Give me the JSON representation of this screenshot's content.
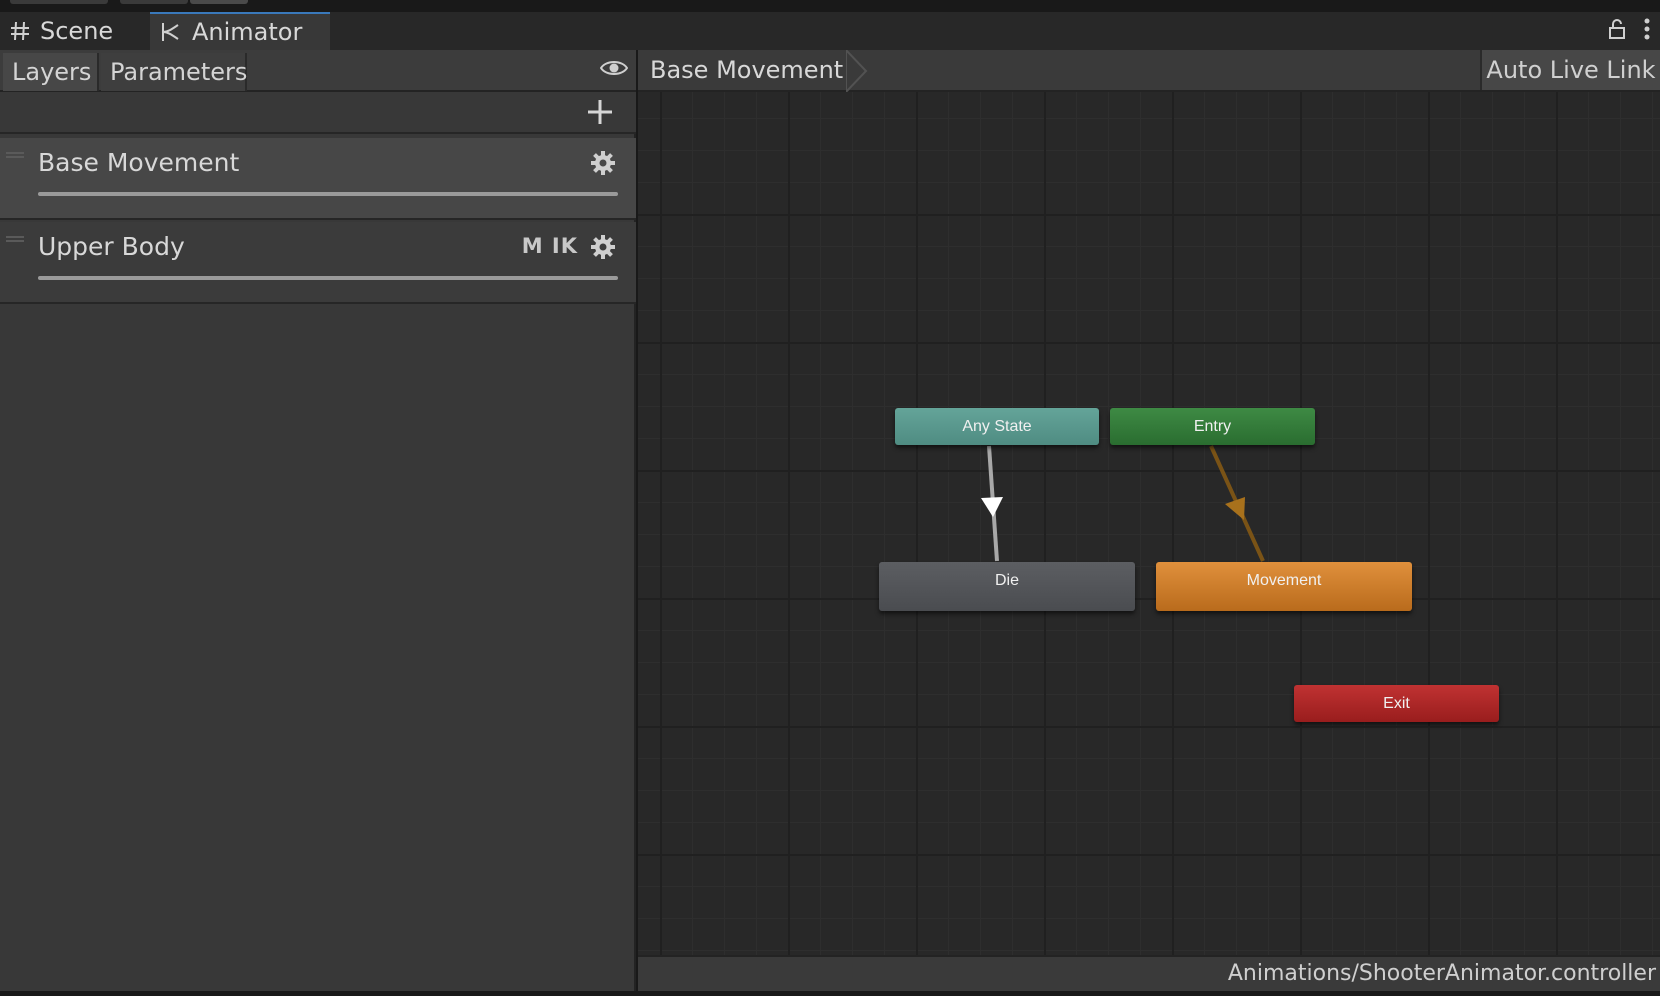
{
  "tabs": {
    "scene_label": "Scene",
    "animator_label": "Animator"
  },
  "left_panel": {
    "layers_tab": "Layers",
    "parameters_tab": "Parameters",
    "layers": [
      {
        "name": "Base Movement",
        "badges": ""
      },
      {
        "name": "Upper Body",
        "badges": "M IK"
      }
    ]
  },
  "graph": {
    "breadcrumb": "Base Movement",
    "auto_live_link": "Auto Live Link",
    "nodes": {
      "any_state": "Any State",
      "entry": "Entry",
      "die": "Die",
      "movement": "Movement",
      "exit": "Exit"
    }
  },
  "status": {
    "controller_path": "Animations/ShooterAnimator.controller"
  },
  "colors": {
    "any_state": "#5b9a90",
    "entry": "#2f7a36",
    "die": "#55575b",
    "movement": "#d07f2c",
    "exit": "#b02828",
    "default_transition": "#b0b0b0",
    "entry_transition": "#8a5a14"
  }
}
